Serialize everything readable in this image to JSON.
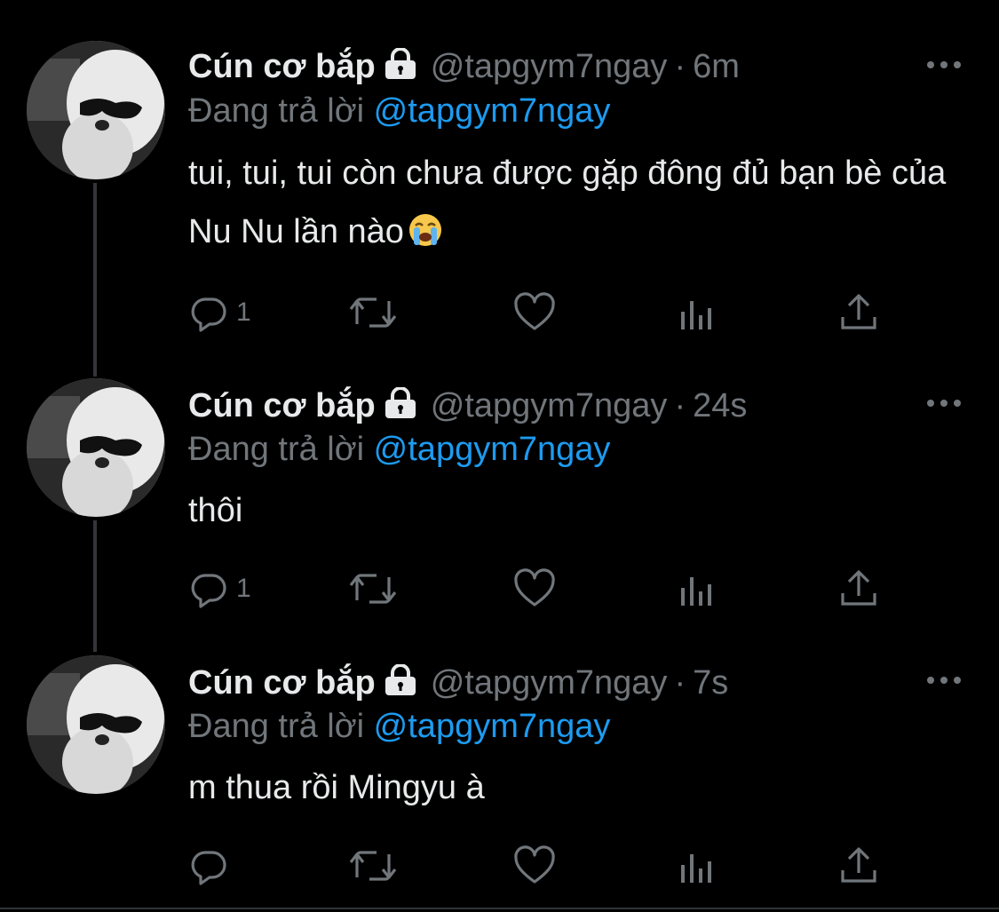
{
  "colors": {
    "background": "#000000",
    "text": "#e7e9ea",
    "muted": "#71767b",
    "link": "#1d9bf0"
  },
  "tweets": [
    {
      "display_name": "Cún cơ bắp",
      "handle": "@tapgym7ngay",
      "separator": "·",
      "time": "6m",
      "reply_prefix": "Đang trả lời",
      "reply_mention": "@tapgym7ngay",
      "text": "tui, tui, tui còn chưa được gặp đông đủ bạn bè của Nu Nu lần nào",
      "emoji": "loudly-crying-face",
      "reply_count": "1",
      "icons": [
        "reply-icon",
        "retweet-icon",
        "like-icon",
        "analytics-icon",
        "share-icon"
      ]
    },
    {
      "display_name": "Cún cơ bắp",
      "handle": "@tapgym7ngay",
      "separator": "·",
      "time": "24s",
      "reply_prefix": "Đang trả lời",
      "reply_mention": "@tapgym7ngay",
      "text": "thôi",
      "reply_count": "1",
      "icons": [
        "reply-icon",
        "retweet-icon",
        "like-icon",
        "analytics-icon",
        "share-icon"
      ]
    },
    {
      "display_name": "Cún cơ bắp",
      "handle": "@tapgym7ngay",
      "separator": "·",
      "time": "7s",
      "reply_prefix": "Đang trả lời",
      "reply_mention": "@tapgym7ngay",
      "text": "m thua rồi Mingyu à",
      "reply_count": "",
      "icons": [
        "reply-icon",
        "retweet-icon",
        "like-icon",
        "analytics-icon",
        "share-icon"
      ]
    }
  ]
}
